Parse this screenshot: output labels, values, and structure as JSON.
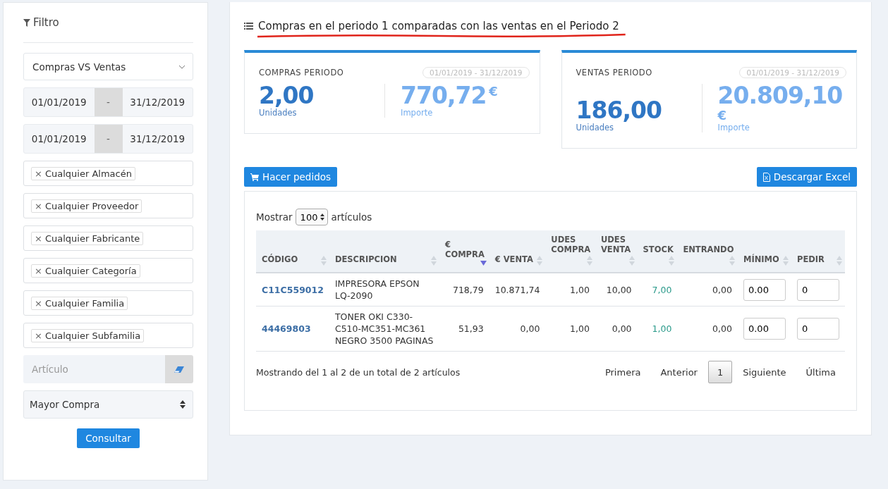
{
  "filter": {
    "title": "Filtro",
    "report_select": "Compras VS Ventas",
    "date_ranges": [
      {
        "from": "01/01/2019",
        "sep": "-",
        "to": "31/12/2019"
      },
      {
        "from": "01/01/2019",
        "sep": "-",
        "to": "31/12/2019"
      }
    ],
    "tags": [
      "Cualquier Almacén",
      "Cualquier Proveedor",
      "Cualquier Fabricante",
      "Cualquier Categoría",
      "Cualquier Familia",
      "Cualquier Subfamilia"
    ],
    "tag_remove": "×",
    "article": {
      "placeholder": "Artículo"
    },
    "order_select": "Mayor Compra",
    "submit": "Consultar"
  },
  "main": {
    "title": "Compras en el periodo 1 comparadas con las ventas en el Periodo 2",
    "cards": [
      {
        "title": "COMPRAS PERIODO",
        "range": "01/01/2019 - 31/12/2019",
        "units": "2,00",
        "units_label": "Unidades",
        "amount": "770,72",
        "currency": "€",
        "amount_label": "Importe"
      },
      {
        "title": "VENTAS PERIODO",
        "range": "01/01/2019 - 31/12/2019",
        "units": "186,00",
        "units_label": "Unidades",
        "amount": "20.809,10",
        "currency": "€",
        "amount_label": "Importe"
      }
    ],
    "order_button": "Hacer pedidos",
    "excel_button": "Descargar Excel",
    "show": {
      "before": "Mostrar",
      "value": "100",
      "after": "artículos"
    },
    "columns": [
      {
        "label": "CÓDIGO",
        "sorted": false
      },
      {
        "label": "DESCRIPCION",
        "sorted": false
      },
      {
        "label": "€ COMPRA",
        "sorted": true
      },
      {
        "label": "€ VENTA",
        "sorted": false
      },
      {
        "label": "UDES COMPRA",
        "sorted": false
      },
      {
        "label": "UDES VENTA",
        "sorted": false
      },
      {
        "label": "STOCK",
        "sorted": false
      },
      {
        "label": "ENTRANDO",
        "sorted": false
      },
      {
        "label": "MÍNIMO",
        "sorted": false
      },
      {
        "label": "PEDIR",
        "sorted": false
      }
    ],
    "rows": [
      {
        "code": "C11C559012",
        "description": "IMPRESORA EPSON LQ-2090",
        "buy": "718,79",
        "sell": "10.871,74",
        "units_buy": "1,00",
        "units_sell": "10,00",
        "stock": "7,00",
        "incoming": "0,00",
        "minimum": "0.00",
        "order": "0"
      },
      {
        "code": "44469803",
        "description": "TONER OKI C330-C510-MC351-MC361 NEGRO 3500 PAGINAS",
        "buy": "51,93",
        "sell": "0,00",
        "units_buy": "1,00",
        "units_sell": "0,00",
        "stock": "1,00",
        "incoming": "0,00",
        "minimum": "0.00",
        "order": "0"
      }
    ],
    "summary": "Mostrando del 1 al 2 de un total de 2 artículos",
    "pages": [
      {
        "label": "Primera",
        "selected": false
      },
      {
        "label": "Anterior",
        "selected": false
      },
      {
        "label": "1",
        "selected": true
      },
      {
        "label": "Siguiente",
        "selected": false
      },
      {
        "label": "Última",
        "selected": false
      }
    ]
  }
}
